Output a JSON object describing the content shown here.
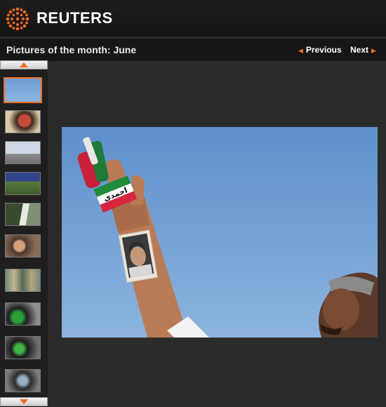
{
  "header": {
    "brand": "REUTERS",
    "brand_color": "#f26b1d",
    "logo_icon": "reuters-dot-logo-icon"
  },
  "gallery": {
    "title": "Pictures of the month: June",
    "prev_label": "Previous",
    "next_label": "Next",
    "prev_icon": "arrow-left-icon",
    "next_icon": "arrow-right-icon"
  },
  "sidebar": {
    "scroll_up_icon": "triangle-up-icon",
    "scroll_down_icon": "triangle-down-icon",
    "thumbnails": [
      {
        "id": "t1",
        "selected": true
      },
      {
        "id": "t2",
        "selected": false
      },
      {
        "id": "t3",
        "selected": false
      },
      {
        "id": "t4",
        "selected": false
      },
      {
        "id": "t5",
        "selected": false
      },
      {
        "id": "t6",
        "selected": false
      },
      {
        "id": "t7",
        "selected": false
      },
      {
        "id": "t8",
        "selected": false
      },
      {
        "id": "t9",
        "selected": false
      },
      {
        "id": "t10",
        "selected": false
      }
    ]
  },
  "photo": {
    "finger_flag_text": "احمدی"
  }
}
